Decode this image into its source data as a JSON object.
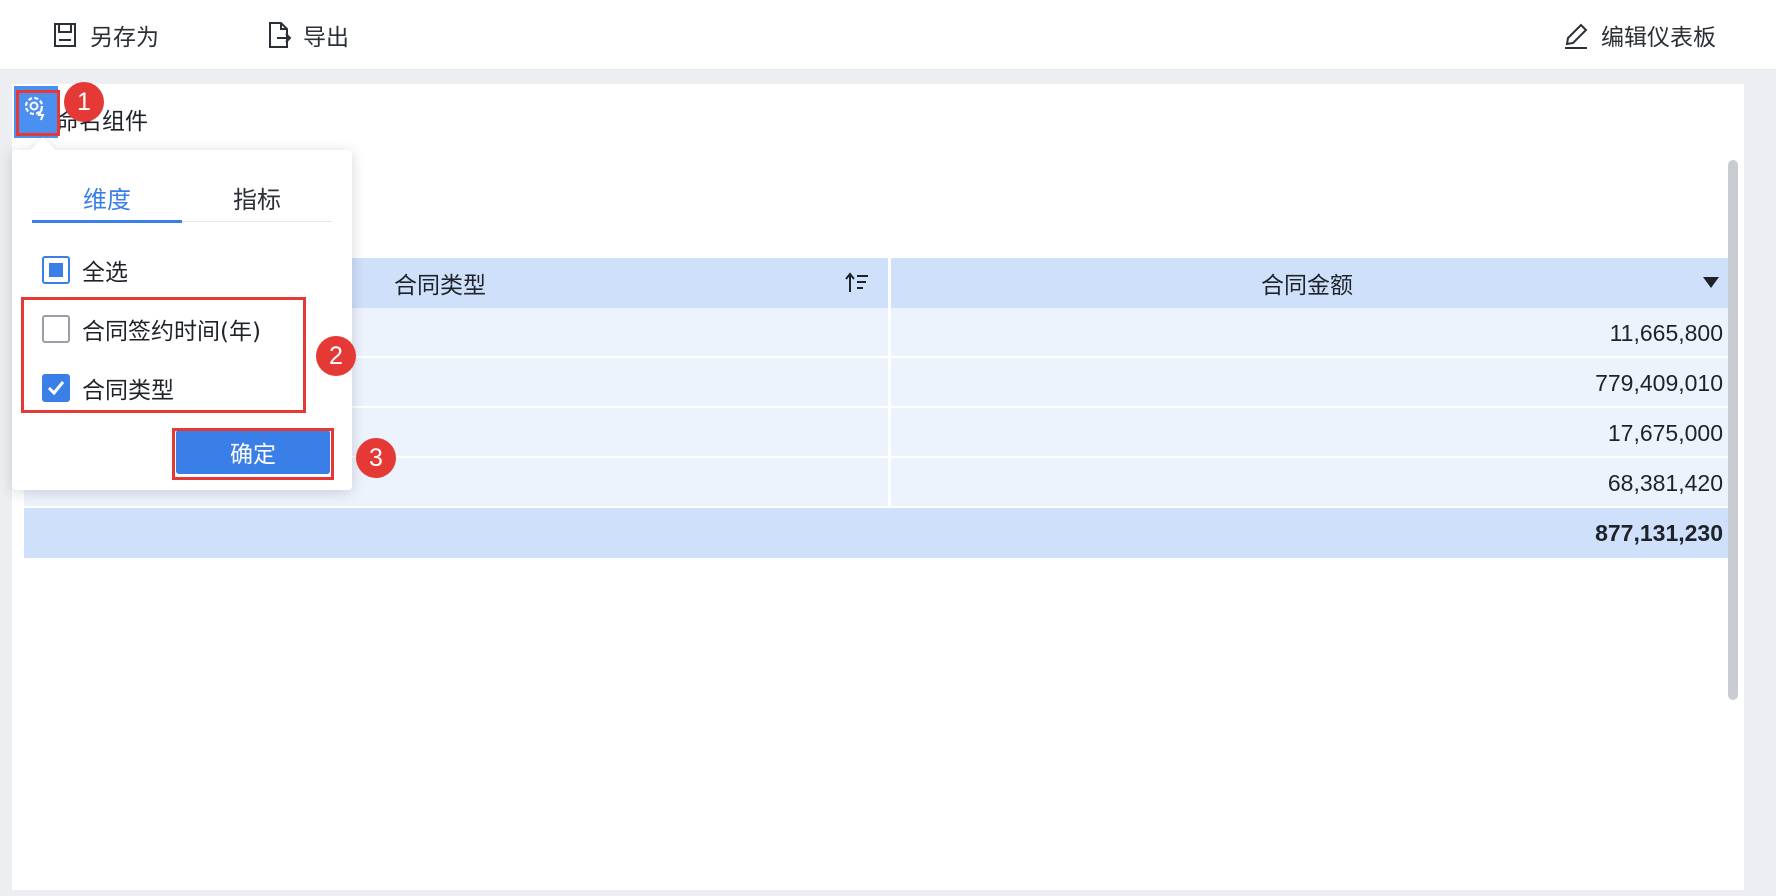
{
  "toolbar": {
    "save_as_label": "另存为",
    "export_label": "导出",
    "edit_dashboard_label": "编辑仪表板"
  },
  "widget": {
    "title": "命名组件"
  },
  "table": {
    "columns": [
      "合同类型",
      "合同金额"
    ],
    "rows": [
      {
        "type": "",
        "amount": "11,665,800"
      },
      {
        "type": "",
        "amount": "779,409,010"
      },
      {
        "type": "",
        "amount": "17,675,000"
      },
      {
        "type": "",
        "amount": "68,381,420"
      }
    ],
    "total": "877,131,230"
  },
  "popup": {
    "tabs": [
      "维度",
      "指标"
    ],
    "active_tab": "维度",
    "select_all_label": "全选",
    "select_all_state": "partial",
    "options": [
      {
        "label": "合同签约时间(年)",
        "checked": false
      },
      {
        "label": "合同类型",
        "checked": true
      }
    ],
    "confirm_label": "确定"
  },
  "annotations": [
    "1",
    "2",
    "3"
  ],
  "colors": {
    "accent": "#3a7ee8",
    "header_bg": "#cfe0fa",
    "row_bg": "#edf3fc",
    "highlight": "#e53935"
  }
}
